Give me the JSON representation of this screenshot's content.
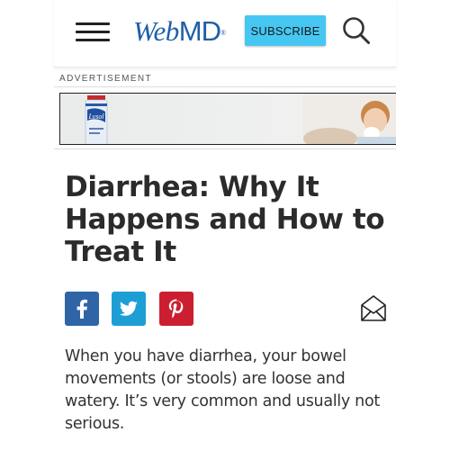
{
  "header": {
    "logo": {
      "part1": "Web",
      "part2": "MD",
      "registered": "®"
    },
    "subscribe_label": "SUBSCRIBE",
    "icons": {
      "menu": "hamburger-menu-icon",
      "search": "search-icon"
    }
  },
  "ad": {
    "label": "ADVERTISEMENT",
    "brand_text": "Lysol"
  },
  "article": {
    "title": "Diarrhea: Why It Happens and How to Treat It",
    "share": [
      {
        "name": "facebook",
        "icon": "facebook-icon",
        "color": "#2f65a6"
      },
      {
        "name": "twitter",
        "icon": "twitter-icon",
        "color": "#1d9fd6"
      },
      {
        "name": "pinterest",
        "icon": "pinterest-icon",
        "color": "#cb1f31"
      }
    ],
    "email_icon": "email-envelope-icon",
    "intro": "When you have diarrhea, your bowel movements (or stools) are loose and watery. It’s very common and usually not serious."
  },
  "colors": {
    "brand_blue": "#1e5fa6",
    "subscribe_bg": "#45c7f2",
    "text_dark": "#2b2b2b"
  }
}
